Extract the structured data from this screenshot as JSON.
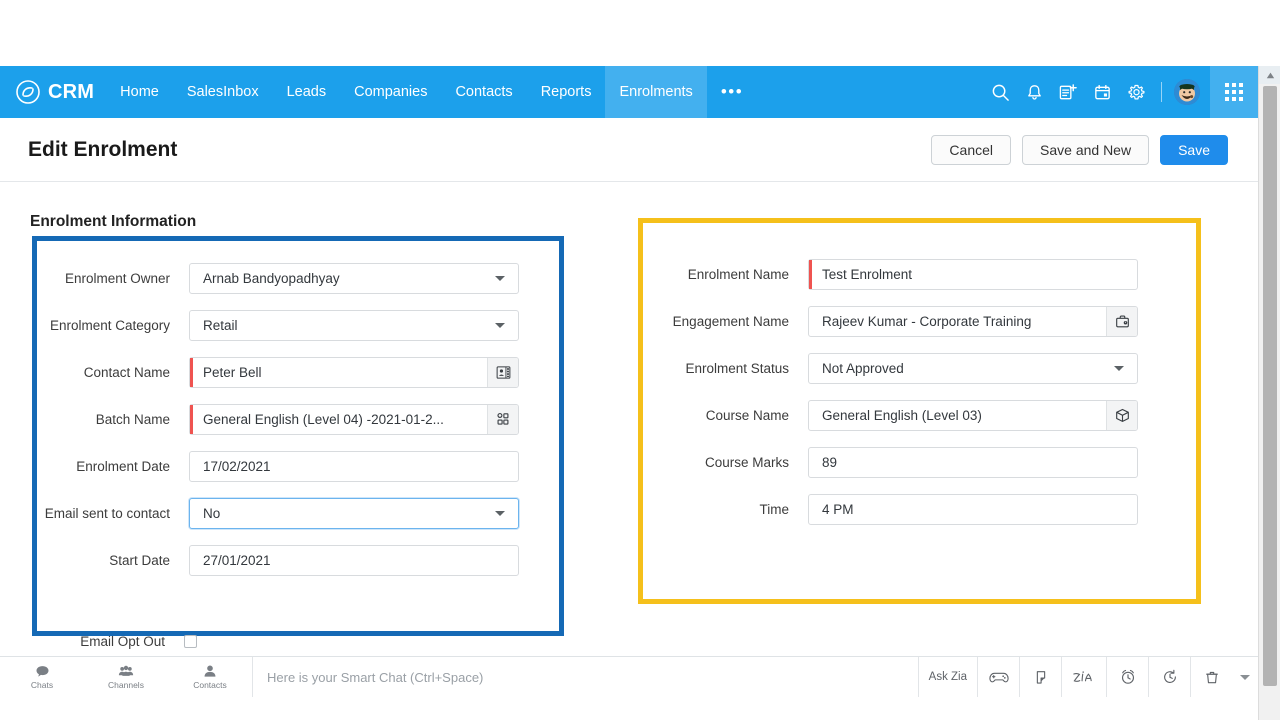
{
  "app": {
    "brand": "CRM",
    "accent_blue": "#1CA0EB",
    "panel_highlight_blue": "#1569B5",
    "panel_highlight_yellow": "#F5C01B",
    "required_marker_color": "#EF5350"
  },
  "nav": {
    "items": [
      {
        "label": "Home",
        "active": false
      },
      {
        "label": "SalesInbox",
        "active": false
      },
      {
        "label": "Leads",
        "active": false
      },
      {
        "label": "Companies",
        "active": false
      },
      {
        "label": "Contacts",
        "active": false
      },
      {
        "label": "Reports",
        "active": false
      },
      {
        "label": "Enrolments",
        "active": true
      }
    ],
    "more_label": "•••",
    "icons": [
      "search-icon",
      "bell-icon",
      "add-note-icon",
      "calendar-icon",
      "gear-icon",
      "avatar",
      "apps-grid-icon"
    ]
  },
  "titlebar": {
    "title": "Edit Enrolment",
    "cancel_label": "Cancel",
    "save_and_new_label": "Save and New",
    "save_label": "Save"
  },
  "form": {
    "section_title": "Enrolment Information",
    "left_fields": [
      {
        "label": "Enrolment Owner",
        "value": "Arnab Bandyopadhyay",
        "type": "select",
        "required": false,
        "focused": false,
        "icon": null
      },
      {
        "label": "Enrolment Category",
        "value": "Retail",
        "type": "select",
        "required": false,
        "focused": false,
        "icon": null
      },
      {
        "label": "Contact Name",
        "value": "Peter Bell",
        "type": "lookup",
        "required": true,
        "focused": false,
        "icon": "contact-card-icon"
      },
      {
        "label": "Batch Name",
        "value": "General English (Level 04) -2021-01-2...",
        "type": "lookup",
        "required": true,
        "focused": false,
        "icon": "module-grid-icon"
      },
      {
        "label": "Enrolment Date",
        "value": "17/02/2021",
        "type": "text",
        "required": false,
        "focused": false,
        "icon": null
      },
      {
        "label": "Email sent to contact",
        "value": "No",
        "type": "select",
        "required": false,
        "focused": true,
        "icon": null
      },
      {
        "label": "Start Date",
        "value": "27/01/2021",
        "type": "text",
        "required": false,
        "focused": false,
        "icon": null
      }
    ],
    "right_fields": [
      {
        "label": "Enrolment Name",
        "value": "Test Enrolment",
        "type": "text",
        "required": true,
        "focused": false,
        "icon": null
      },
      {
        "label": "Engagement Name",
        "value": "Rajeev Kumar - Corporate Training",
        "type": "lookup",
        "required": false,
        "focused": false,
        "icon": "briefcase-icon"
      },
      {
        "label": "Enrolment Status",
        "value": "Not Approved",
        "type": "select",
        "required": false,
        "focused": false,
        "icon": null
      },
      {
        "label": "Course Name",
        "value": "General English (Level 03)",
        "type": "lookup",
        "required": false,
        "focused": false,
        "icon": "box-icon"
      },
      {
        "label": "Course Marks",
        "value": "89",
        "type": "text",
        "required": false,
        "focused": false,
        "icon": null
      },
      {
        "label": "Time",
        "value": "4 PM",
        "type": "text",
        "required": false,
        "focused": false,
        "icon": null
      }
    ],
    "email_opt_out": {
      "label": "Email Opt Out",
      "checked": false
    }
  },
  "bottombar": {
    "tabs": [
      {
        "label": "Chats",
        "icon": "chat-bubble-icon"
      },
      {
        "label": "Channels",
        "icon": "channels-icon"
      },
      {
        "label": "Contacts",
        "icon": "person-icon"
      }
    ],
    "smart_chat_placeholder": "Here is your Smart Chat (Ctrl+Space)",
    "right_items": [
      {
        "label": "Ask Zia",
        "icon": null
      },
      {
        "label": "",
        "icon": "game-controller-icon"
      },
      {
        "label": "",
        "icon": "flag-cursor-icon"
      },
      {
        "label": "",
        "icon": "zia-script-icon"
      },
      {
        "label": "",
        "icon": "alarm-clock-icon"
      },
      {
        "label": "",
        "icon": "clock-history-icon"
      },
      {
        "label": "",
        "icon": "trash-icon"
      }
    ]
  }
}
